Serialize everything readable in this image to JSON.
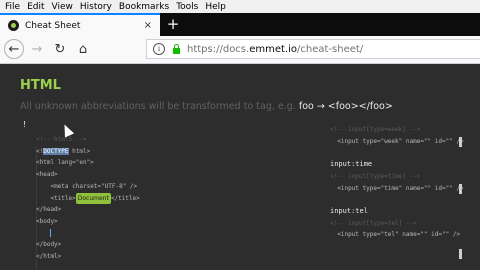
{
  "menu": [
    "File",
    "Edit",
    "View",
    "History",
    "Bookmarks",
    "Tools",
    "Help"
  ],
  "tab": {
    "title": "Cheat Sheet",
    "close": "×",
    "new": "+"
  },
  "nav": {
    "back": "←",
    "forward": "→",
    "reload": "↻",
    "home": "⌂",
    "url_prefix": "https://docs.",
    "url_host": "emmet.io",
    "url_path": "/cheat-sheet/",
    "info": "i"
  },
  "page": {
    "heading": "HTML",
    "desc_before": "All unknown abbreviations will be transformed to tag, e.g. ",
    "desc_code": "foo → <foo></foo>",
    "bang": "!",
    "left_code": {
      "comment": "<!-- html5 -->",
      "doctype_open": "<!",
      "doctype_word": "DOCTYPE",
      "doctype_close": " html>",
      "html_open": "<html lang=\"en\">",
      "head_open": "<head>",
      "meta": "<meta charset=\"UTF-8\" />",
      "title_open": "<title>",
      "title_badge": "Document",
      "title_close": "</title>",
      "head_close": "</head>",
      "body_open": "<body>",
      "body_close": "</body>",
      "html_close": "</html>"
    },
    "right_code": {
      "week_comment": "<!-- input[type=week] -->",
      "week": "<input type=\"week\" name=\"\" id=\"\" />",
      "time_label": "input:time",
      "time_comment": "<!-- input[type=time] -->",
      "time": "<input type=\"time\" name=\"\" id=\"\" />",
      "tel_label": "input:tel",
      "tel_comment": "<!-- input[type=tel] -->",
      "tel": "<input type=\"tel\" name=\"\" id=\"\" />"
    }
  },
  "colors": {
    "accent": "#9cd14e",
    "tab_highlight": "#0a84ff",
    "background": "#2d2d2d"
  }
}
